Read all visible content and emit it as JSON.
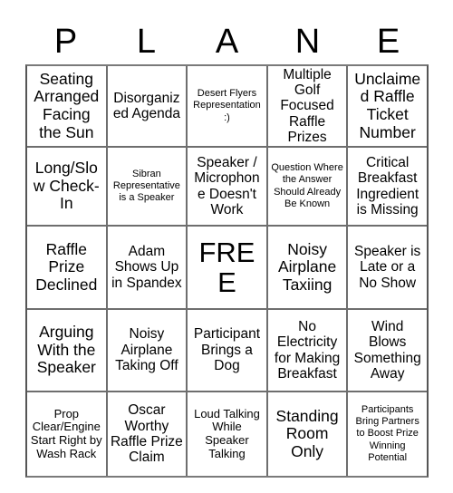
{
  "card": {
    "title": "PLANE",
    "header_letters": [
      "P",
      "L",
      "A",
      "N",
      "E"
    ],
    "columns": 5,
    "rows": 5,
    "free_space": {
      "row": 2,
      "column": 2,
      "label": "FREE"
    },
    "grid": [
      [
        {
          "text": "Seating Arranged Facing the Sun",
          "size": "lg",
          "marked": false
        },
        {
          "text": "Disorganized Agenda",
          "size": "md",
          "marked": false
        },
        {
          "text": "Desert Flyers Representation :)",
          "size": "xs",
          "marked": false
        },
        {
          "text": "Multiple Golf Focused Raffle Prizes",
          "size": "md",
          "marked": false
        },
        {
          "text": "Unclaimed Raffle Ticket Number",
          "size": "lg",
          "marked": false
        }
      ],
      [
        {
          "text": "Long/Slow Check-In",
          "size": "lg",
          "marked": false
        },
        {
          "text": "Sibran Representative is a Speaker",
          "size": "xs",
          "marked": false
        },
        {
          "text": "Speaker / Microphone Doesn't Work",
          "size": "md",
          "marked": false
        },
        {
          "text": "Question Where the Answer Should Already Be Known",
          "size": "xs",
          "marked": false
        },
        {
          "text": "Critical Breakfast Ingredient is Missing",
          "size": "md",
          "marked": false
        }
      ],
      [
        {
          "text": "Raffle Prize Declined",
          "size": "lg",
          "marked": false
        },
        {
          "text": "Adam Shows Up in Spandex",
          "size": "md",
          "marked": false
        },
        {
          "text": "FREE",
          "size": "xl",
          "marked": false
        },
        {
          "text": "Noisy Airplane Taxiing",
          "size": "lg",
          "marked": false
        },
        {
          "text": "Speaker is Late or a No Show",
          "size": "md",
          "marked": false
        }
      ],
      [
        {
          "text": "Arguing With the Speaker",
          "size": "lg",
          "marked": false
        },
        {
          "text": "Noisy Airplane Taking Off",
          "size": "md",
          "marked": false
        },
        {
          "text": "Participant Brings a Dog",
          "size": "md",
          "marked": false
        },
        {
          "text": "No Electricity for Making Breakfast",
          "size": "md",
          "marked": false
        },
        {
          "text": "Wind Blows Something Away",
          "size": "md",
          "marked": false
        }
      ],
      [
        {
          "text": "Prop Clear/Engine Start Right by Wash Rack",
          "size": "sm",
          "marked": false
        },
        {
          "text": "Oscar Worthy Raffle Prize Claim",
          "size": "md",
          "marked": false
        },
        {
          "text": "Loud Talking While Speaker Talking",
          "size": "sm",
          "marked": false
        },
        {
          "text": "Standing Room Only",
          "size": "lg",
          "marked": false
        },
        {
          "text": "Participants Bring Partners to Boost Prize Winning Potential",
          "size": "xs",
          "marked": false
        }
      ]
    ]
  },
  "colors": {
    "background": "#ffffff",
    "text": "#000000",
    "grid_line": "#6e6e6e",
    "grid_outer": "#555555"
  }
}
